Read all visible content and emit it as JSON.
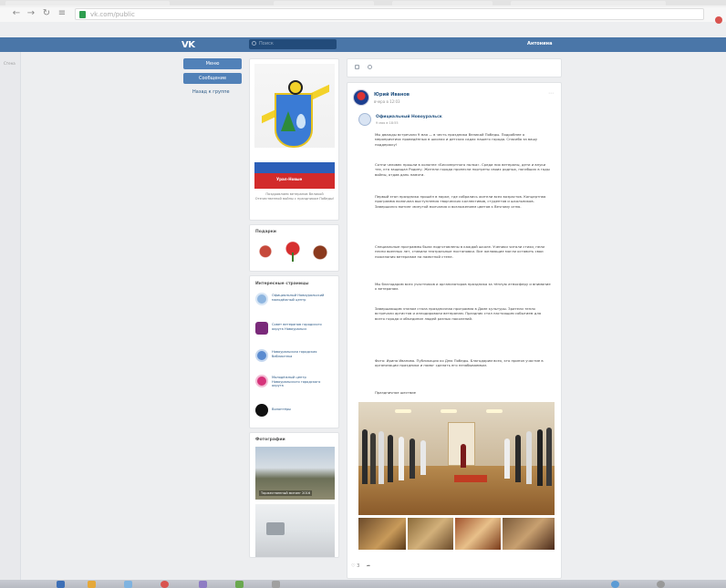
{
  "browser": {
    "url": "vk.com/public",
    "back_icon": "arrow-left-icon",
    "forward_icon": "arrow-right-icon",
    "reload_icon": "reload-icon",
    "lock_color": "#2e9e4f"
  },
  "vk": {
    "logo": "VK",
    "search_placeholder": "Поиск",
    "user_name": "Антонина",
    "brand_color": "#4a76a8"
  },
  "gutter": {
    "label": "Стена"
  },
  "actions": {
    "primary": "Меню",
    "secondary": "Сообщение",
    "link": "Назад к группе"
  },
  "community": {
    "emblem_caption": "Урал-Новые",
    "note": "Поздравляем ветеранов Великой Отечественной войны с праздником Победы!"
  },
  "gifts": {
    "title": "Подарки"
  },
  "groups": {
    "title": "Интересные страницы",
    "items": [
      {
        "name": "Официальный Новоуральский молодёжный центр"
      },
      {
        "name": "Совет ветеранов городского округа Новоуральск"
      },
      {
        "name": "Новоуральская городская библиотека"
      },
      {
        "name": "Молодёжный центр Новоуральского городского округа"
      },
      {
        "name": "Волонтёры"
      }
    ]
  },
  "photos": {
    "title": "Фотографии",
    "caption1": "Торжественный митинг 2016",
    "caption2": ""
  },
  "post": {
    "author": "Юрий Иванов",
    "date": "вчера в 12:03",
    "repost_author": "Официальный Новоуральск",
    "repost_date": "9 мая в 18:55",
    "paragraphs": [
      "Мы дважды встречали 9 мая — в честь праздника Великой Победы. Подробнее о мероприятиях проведённых в школах и детских садах нашего города. Спасибо за вашу поддержку!",
      "Сотни человек прошли в колонне «Бессмертного полка». Среди них ветераны, дети и внуки тех, кто защищал Родину. Жители города пронесли портреты своих родных, погибших в годы войны, отдав дань памяти.",
      "Первый этап праздника прошёл в парке, где собрались жители всех возрастов. Концертная программа включала выступления творческих коллективов, студентов и школьников. Завершился митинг минутой молчания и возложением цветов к Вечному огню.",
      "Специальные программы были подготовлены в каждой школе. Ученики читали стихи, пели песни военных лет, ставили театральные постановки. Все желающие могли оставить свои пожелания ветеранам на памятной стене.",
      "Мы благодарим всех участников и организаторов праздника за тёплую атмосферу и внимание к ветеранам.",
      "Завершающим этапом стала праздничная программа в Доме культуры. Зрители тепло встречали артистов и аплодировали ветеранам. Праздник стал настоящим событием для всего города и объединил людей разных поколений.",
      "Фото: Ирина Иванова. Публикация ко Дню Победы. Благодарим всех, кто принял участие в организации праздника и помог сделать его незабываемым.",
      "Праздничное шествие"
    ],
    "likes": "3"
  }
}
